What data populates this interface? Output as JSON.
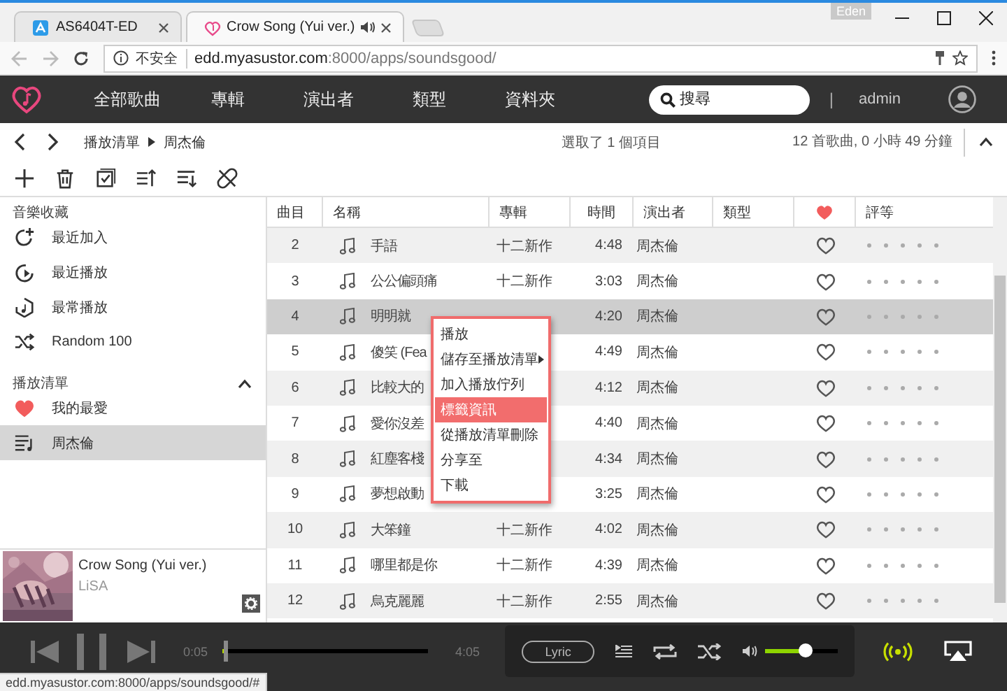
{
  "browser": {
    "profile": "Eden",
    "tabs": [
      {
        "title": "AS6404T-ED",
        "selected": false,
        "audio": false
      },
      {
        "title": "Crow Song (Yui ver.)",
        "selected": true,
        "audio": true
      }
    ],
    "security": "不安全",
    "url_host": "edd.myasustor.com",
    "url_rest": ":8000/apps/soundsgood/"
  },
  "nav": {
    "items": [
      "全部歌曲",
      "專輯",
      "演出者",
      "類型",
      "資料夾"
    ],
    "search_placeholder": "搜尋",
    "separator": "|",
    "user": "admin"
  },
  "breadcrumb": [
    "播放清單",
    "周杰倫"
  ],
  "selection_info": "選取了 1 個項目",
  "summary": "12 首歌曲, 0 小時 49 分鐘",
  "sidebar": {
    "sections": [
      {
        "title": "音樂收藏",
        "collapsible": false,
        "items": [
          {
            "label": "最近加入",
            "selected": false
          },
          {
            "label": "最近播放",
            "selected": false
          },
          {
            "label": "最常播放",
            "selected": false
          },
          {
            "label": "Random 100",
            "selected": false
          }
        ]
      },
      {
        "title": "播放清單",
        "collapsible": true,
        "items": [
          {
            "label": "我的最愛",
            "selected": false
          },
          {
            "label": "周杰倫",
            "selected": true
          }
        ]
      }
    ]
  },
  "now_playing": {
    "title": "Crow Song (Yui ver.)",
    "artist": "LiSA"
  },
  "table": {
    "columns": [
      {
        "kind": "text",
        "label": "曲目"
      },
      {
        "kind": "text",
        "label": "名稱"
      },
      {
        "kind": "text",
        "label": "專輯"
      },
      {
        "kind": "text",
        "label": "時間"
      },
      {
        "kind": "text",
        "label": "演出者"
      },
      {
        "kind": "text",
        "label": "類型"
      },
      {
        "kind": "favorite"
      },
      {
        "kind": "text",
        "label": "評等"
      }
    ],
    "rows": [
      {
        "track": "2",
        "name": "手語",
        "album": "十二新作",
        "time": "4:48",
        "artist": "周杰倫",
        "favorite": false,
        "stars": 0,
        "selected": false
      },
      {
        "track": "3",
        "name": "公公偏頭痛",
        "album": "十二新作",
        "time": "3:03",
        "artist": "周杰倫",
        "favorite": false,
        "stars": 0,
        "selected": false
      },
      {
        "track": "4",
        "name": "明明就",
        "time": "4:20",
        "artist": "周杰倫",
        "favorite": false,
        "stars": 0,
        "selected": true
      },
      {
        "track": "5",
        "name": "傻笑 (Fea",
        "time": "4:49",
        "artist": "周杰倫",
        "favorite": false,
        "stars": 0,
        "selected": false
      },
      {
        "track": "6",
        "name": "比較大的",
        "time": "4:12",
        "artist": "周杰倫",
        "favorite": false,
        "stars": 0,
        "selected": false
      },
      {
        "track": "7",
        "name": "愛你沒差",
        "time": "4:40",
        "artist": "周杰倫",
        "favorite": false,
        "stars": 0,
        "selected": false
      },
      {
        "track": "8",
        "name": "紅塵客棧",
        "time": "4:34",
        "artist": "周杰倫",
        "favorite": false,
        "stars": 0,
        "selected": false
      },
      {
        "track": "9",
        "name": "夢想啟動",
        "time": "3:25",
        "artist": "周杰倫",
        "favorite": false,
        "stars": 0,
        "selected": false
      },
      {
        "track": "10",
        "name": "大笨鐘",
        "album": "十二新作",
        "time": "4:02",
        "artist": "周杰倫",
        "favorite": false,
        "stars": 0,
        "selected": false
      },
      {
        "track": "11",
        "name": "哪里都是你",
        "album": "十二新作",
        "time": "4:39",
        "artist": "周杰倫",
        "favorite": false,
        "stars": 0,
        "selected": false
      },
      {
        "track": "12",
        "name": "烏克麗麗",
        "album": "十二新作",
        "time": "2:55",
        "artist": "周杰倫",
        "favorite": false,
        "stars": 0,
        "selected": false
      }
    ]
  },
  "context_menu": [
    {
      "label": "播放",
      "selected": false,
      "submenu": false
    },
    {
      "label": "儲存至播放清單",
      "selected": false,
      "submenu": true
    },
    {
      "label": "加入播放佇列",
      "selected": false,
      "submenu": false
    },
    {
      "label": "標籤資訊",
      "selected": true,
      "submenu": false
    },
    {
      "label": "從播放清單刪除",
      "selected": false,
      "submenu": false
    },
    {
      "label": "分享至",
      "selected": false,
      "submenu": false
    },
    {
      "label": "下載",
      "selected": false,
      "submenu": false
    }
  ],
  "player": {
    "elapsed": "0:05",
    "total": "4:05",
    "progress": {
      "level": 0.02
    },
    "lyric_button": "Lyric",
    "volume": {
      "level": 0.55
    }
  },
  "status_url": "edd.myasustor.com:8000/apps/soundsgood/#"
}
